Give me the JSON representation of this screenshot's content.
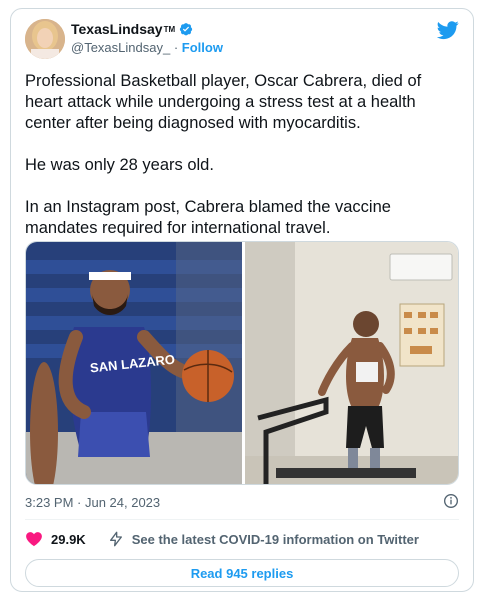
{
  "header": {
    "display_name": "TexasLindsay",
    "tm": "TM",
    "handle": "@TexasLindsay_",
    "separator": "·",
    "follow_label": "Follow",
    "icons": {
      "verified": "verified-badge-icon",
      "logo": "twitter-bird-icon"
    }
  },
  "tweet": {
    "paragraphs": [
      "Professional Basketball player, Oscar Cabrera, died of heart attack while undergoing a stress test at a health center after being diagnosed with myocarditis.",
      "He was only 28 years old.",
      "In an Instagram post, Cabrera blamed the vaccine mandates required for international travel."
    ]
  },
  "media": {
    "jersey_text": "SAN LAZARO"
  },
  "footer": {
    "timestamp": "3:23 PM · Jun 24, 2023",
    "like_count": "29.9K",
    "covid_link": "See the latest COVID-19 information on Twitter",
    "replies_button": "Read 945 replies"
  },
  "colors": {
    "accent": "#1d9bf0",
    "heart": "#f91880",
    "muted": "#536471",
    "border": "#cfd9de"
  }
}
